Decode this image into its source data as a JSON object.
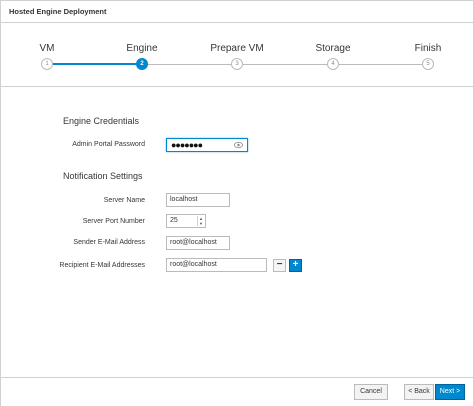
{
  "dialog": {
    "title": "Hosted Engine Deployment"
  },
  "wizard": {
    "steps": [
      {
        "label": "VM",
        "number": "1"
      },
      {
        "label": "Engine",
        "number": "2"
      },
      {
        "label": "Prepare VM",
        "number": "3"
      },
      {
        "label": "Storage",
        "number": "4"
      },
      {
        "label": "Finish",
        "number": "5"
      }
    ],
    "active_step": 2
  },
  "engine_credentials": {
    "heading": "Engine Credentials",
    "password_label": "Admin Portal Password",
    "password_value": "●●●●●●●"
  },
  "notification": {
    "heading": "Notification Settings",
    "server_name_label": "Server Name",
    "server_name_value": "localhost",
    "server_port_label": "Server Port Number",
    "server_port_value": "25",
    "sender_label": "Sender E-Mail Address",
    "sender_value": "root@localhost",
    "recipient_label": "Recipient E-Mail Addresses",
    "recipient_value": "root@localhost",
    "remove_symbol": "−",
    "add_symbol": "+"
  },
  "footer": {
    "cancel_label": "Cancel",
    "back_label": "< Back",
    "next_label": "Next >"
  },
  "colors": {
    "accent": "#0088ce",
    "border": "#bbbbbb"
  },
  "icons": [
    "eye-icon",
    "spin-up-icon",
    "spin-down-icon",
    "minus-icon",
    "plus-icon"
  ]
}
